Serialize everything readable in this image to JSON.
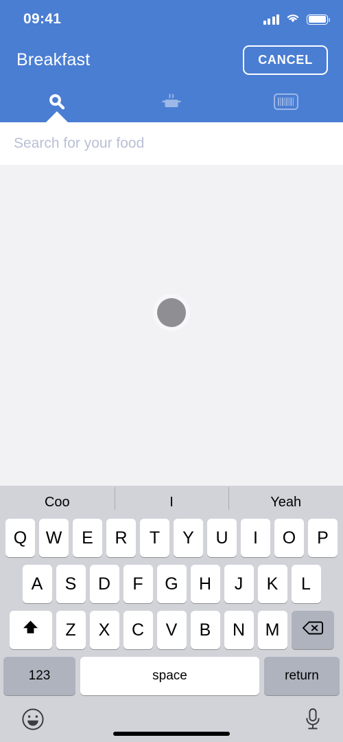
{
  "status_bar": {
    "time": "09:41",
    "cellular_icon": "cellular-bars-icon",
    "wifi_icon": "wifi-icon",
    "battery_icon": "battery-full-icon"
  },
  "header": {
    "title": "Breakfast",
    "cancel_label": "CANCEL",
    "background_color": "#4a7ed3",
    "tabs": [
      {
        "id": "search",
        "icon": "search-icon",
        "active": true
      },
      {
        "id": "meal",
        "icon": "cooking-pot-icon",
        "active": false
      },
      {
        "id": "barcode",
        "icon": "barcode-scanner-icon",
        "active": false
      }
    ]
  },
  "search": {
    "placeholder": "Search for your food",
    "value": ""
  },
  "content": {
    "loading_indicator": "loading-spinner",
    "spinner_color": "#8e8e93",
    "background_color": "#f2f1f4"
  },
  "keyboard": {
    "suggestions": [
      "Coo",
      "I",
      "Yeah"
    ],
    "row1": [
      "Q",
      "W",
      "E",
      "R",
      "T",
      "Y",
      "U",
      "I",
      "O",
      "P"
    ],
    "row2": [
      "A",
      "S",
      "D",
      "F",
      "G",
      "H",
      "J",
      "K",
      "L"
    ],
    "row3": [
      "Z",
      "X",
      "C",
      "V",
      "B",
      "N",
      "M"
    ],
    "shift_icon": "shift-arrow-icon",
    "backspace_icon": "backspace-delete-icon",
    "numbers_label": "123",
    "space_label": "space",
    "return_label": "return",
    "emoji_icon": "emoji-smiley-icon",
    "dictation_icon": "microphone-icon",
    "background_color": "#d1d3d9"
  }
}
